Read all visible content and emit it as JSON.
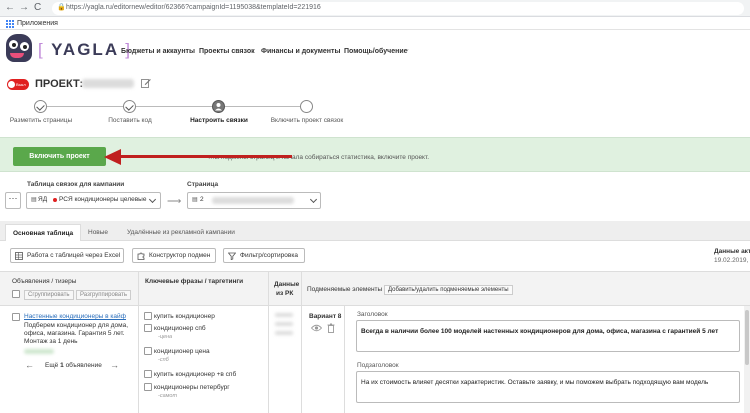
{
  "browser": {
    "back_glyph": "←",
    "forward_glyph": "→",
    "reload_glyph": "C",
    "lock_glyph": "🔒",
    "url": "https://yagla.ru/editornew/editor/62366?campaignId=1195038&templateId=221916",
    "bookmarks_label": "Приложения"
  },
  "header": {
    "logo_text": "YAGLA",
    "logo_bracket_open": "[",
    "logo_bracket_close": "]",
    "nav": [
      {
        "label": "Бюджеты и аккаунты"
      },
      {
        "label": "Проекты связок"
      },
      {
        "label": "Финансы и документы"
      },
      {
        "label": "Помощь/обучение"
      }
    ],
    "nav_dropdown_glyph": "⌄"
  },
  "project": {
    "toggle_text": "Выкл",
    "label": "ПРОЕКТ:"
  },
  "stepper": {
    "steps": [
      {
        "label": "Разметить страницы",
        "state": "done"
      },
      {
        "label": "Поставить код",
        "state": "done"
      },
      {
        "label": "Настроить связки",
        "state": "active"
      },
      {
        "label": "Включить проект связок",
        "state": "todo"
      }
    ]
  },
  "banner": {
    "button_label": "Включить проект",
    "message": "…ы подмены страниц и начала собираться статистика, включите проект.",
    "background_color": "#e0f1e0",
    "button_color": "#5aa84b",
    "arrow_color": "#c0201f"
  },
  "selectors": {
    "table_label": "Таблица связок для кампании",
    "page_label": "Страница",
    "dots": "···",
    "campaign_prefix": "ЯД",
    "campaign_value": "РСЯ кондиционеры целевые",
    "page_prefix": "2",
    "swap_glyph": "⟶"
  },
  "tabs": [
    {
      "label": "Основная таблица",
      "active": true
    },
    {
      "label": "Новые",
      "active": false
    },
    {
      "label": "Удалённые из рекламной кампании",
      "active": false
    }
  ],
  "toolbar": {
    "excel_label": "Работа с таблицей через Excel",
    "constructor_label": "Конструктор подмен",
    "filter_label": "Фильтр/сортировка",
    "data_label": "Данные акт",
    "data_date": "19.02.2019,"
  },
  "table": {
    "col_ads": "Объявления / тизеры",
    "group_btn": "Сгруппировать",
    "ungroup_btn": "Разгруппировать",
    "col_keywords": "Ключевые фразы / таргетинги",
    "col_data_line1": "Данные",
    "col_data_line2": "из РК",
    "col_elements": "Подменяемые элементы",
    "add_remove_btn": "Добавить/удалить подменяемые элементы",
    "ad": {
      "title": "Настенные кондиционеры в кайф",
      "body_lines": [
        "Подберем кондиционер для дома,",
        "офиса, магазина. Гарантия 5 лет.",
        "Монтаж за 1 день"
      ],
      "more_prefix": "Ещё",
      "more_count": "1",
      "more_suffix": "объявление",
      "prev_glyph": "←",
      "next_glyph": "→"
    },
    "keywords": [
      {
        "text": "купить кондиционер",
        "sub": ""
      },
      {
        "text": "кондиционер спб",
        "sub": "-цена"
      },
      {
        "text": "кондиционер цена",
        "sub": "-спб"
      },
      {
        "text": "купить кондиционер +в спб",
        "sub": ""
      },
      {
        "text": "кондиционеры петербург",
        "sub": "-самот"
      }
    ],
    "variant_label": "Вариант 8",
    "headline_label": "Заголовок",
    "headline_value": "Всегда в наличии более 100 моделей настенных кондиционеров для дома, офиса, магазина с гарантией 5 лет",
    "subheadline_label": "Подзаголовок",
    "subheadline_value": "На их стоимость влияет десятки характеристик. Оставьте заявку, и мы поможем выбрать подходящую вам модель"
  }
}
